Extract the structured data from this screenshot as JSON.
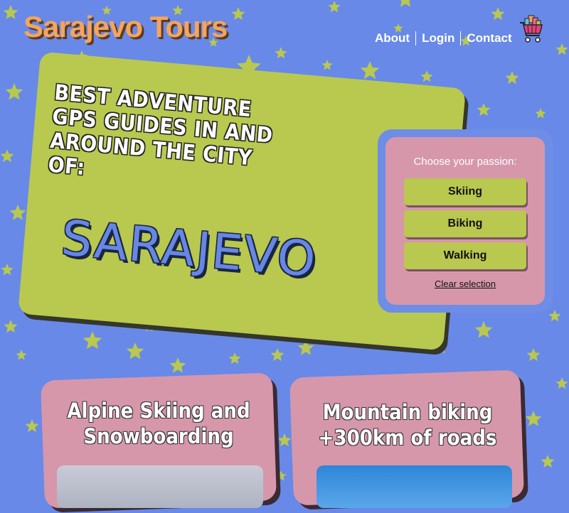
{
  "header": {
    "site_title": "Sarajevo Tours",
    "nav": [
      {
        "label": "About"
      },
      {
        "label": "Login"
      },
      {
        "label": "Contact"
      }
    ],
    "cart_icon": "shopping-cart-icon"
  },
  "hero": {
    "headline": "Best adventure GPS guides in and around the city of:",
    "city": "Sarajevo"
  },
  "passion": {
    "title": "Choose your passion:",
    "options": [
      {
        "label": "Skiing"
      },
      {
        "label": "Biking"
      },
      {
        "label": "Walking"
      }
    ],
    "clear_label": "Clear selection"
  },
  "cards": [
    {
      "title": "Alpine Skiing and Snowboarding"
    },
    {
      "title": "Mountain biking +300km of roads"
    }
  ],
  "colors": {
    "background": "#6889e8",
    "stars": "#b9c84f",
    "hero_card": "#b9c84f",
    "passion_box": "#d697ab",
    "title_orange": "#f4a45e"
  }
}
